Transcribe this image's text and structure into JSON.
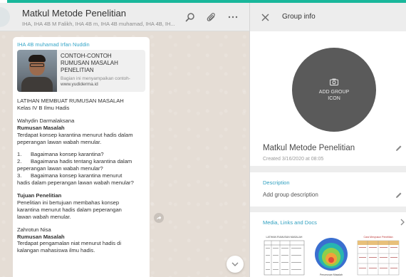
{
  "theme": {
    "accent": "#19b79b",
    "link": "#2e9fbf",
    "sender": "#35a6c8",
    "wallpaper": "#e5ddd5"
  },
  "chat": {
    "title": "Matkul Metode Penelitian",
    "subtitle": "IHA, IHA 4B M Falikh, IHA 4B m, IHA 4B muhamad, IHA 4B, IH...",
    "icons": [
      "search-icon",
      "attach-icon",
      "menu-icon"
    ],
    "message": {
      "sender": "IHA 4B muhamad Irfan Nuddin",
      "preview": {
        "title": "CONTOH-CONTOH RUMUSAN MASALAH PENELITIAN",
        "description": "Bagian ini menyampaikan contoh-",
        "url": "www.yudiderma.id"
      },
      "lines": [
        {
          "t": "LATIHAN MEMBUAT RUMUSAN MASALAH"
        },
        {
          "t": "Kelas IV B Ilmu Hadis"
        },
        {
          "gap": true
        },
        {
          "t": "Wahydin Darmalaksana"
        },
        {
          "t": "Rumusan Masalah",
          "bold": true
        },
        {
          "t": "Terdapat konsep karantina menurut hadis dalam"
        },
        {
          "t": "peperangan lawan wabah menular."
        },
        {
          "gap": true
        },
        {
          "t": "1.      Bagaimana konsep karantina?"
        },
        {
          "t": "2.      Bagaimana hadis tentang karantina dalam"
        },
        {
          "t": "peperangan lawan wabah menular?"
        },
        {
          "t": "3.      Bagaimana konsep karantina menurut"
        },
        {
          "t": "hadis dalam peperangan lawan wabah menular?"
        },
        {
          "gap": true
        },
        {
          "t": "Tujuan Penelitian",
          "bold": true
        },
        {
          "t": "Penelitian ini bertujuan membahas konsep"
        },
        {
          "t": "karantina menurut hadis dalam peperangan"
        },
        {
          "t": "lawan wabah menular."
        },
        {
          "gap": true
        },
        {
          "t": "Zahrotun Nisa"
        },
        {
          "t": "Rumusan Masalah",
          "bold": true
        },
        {
          "t": "Terdapat pengamalan niat menurut hadis di"
        },
        {
          "t": "kalangan mahasiswa ilmu hadis."
        }
      ]
    }
  },
  "info": {
    "header_title": "Group info",
    "group_icon_label": "ADD GROUP ICON",
    "group_name": "Matkul Metode Penelitian",
    "created": "Created 3/16/2020 at 08:05",
    "description_label": "Description",
    "description_placeholder": "Add group description",
    "media_label": "Media, Links and Docs",
    "media": [
      {
        "kind": "document",
        "title": "LATIHAN RUMUSAN MASALAH"
      },
      {
        "kind": "diagram",
        "caption": "Perumusan Masalah"
      },
      {
        "kind": "table",
        "title": "Cara Menyusun Penelitian"
      }
    ]
  }
}
